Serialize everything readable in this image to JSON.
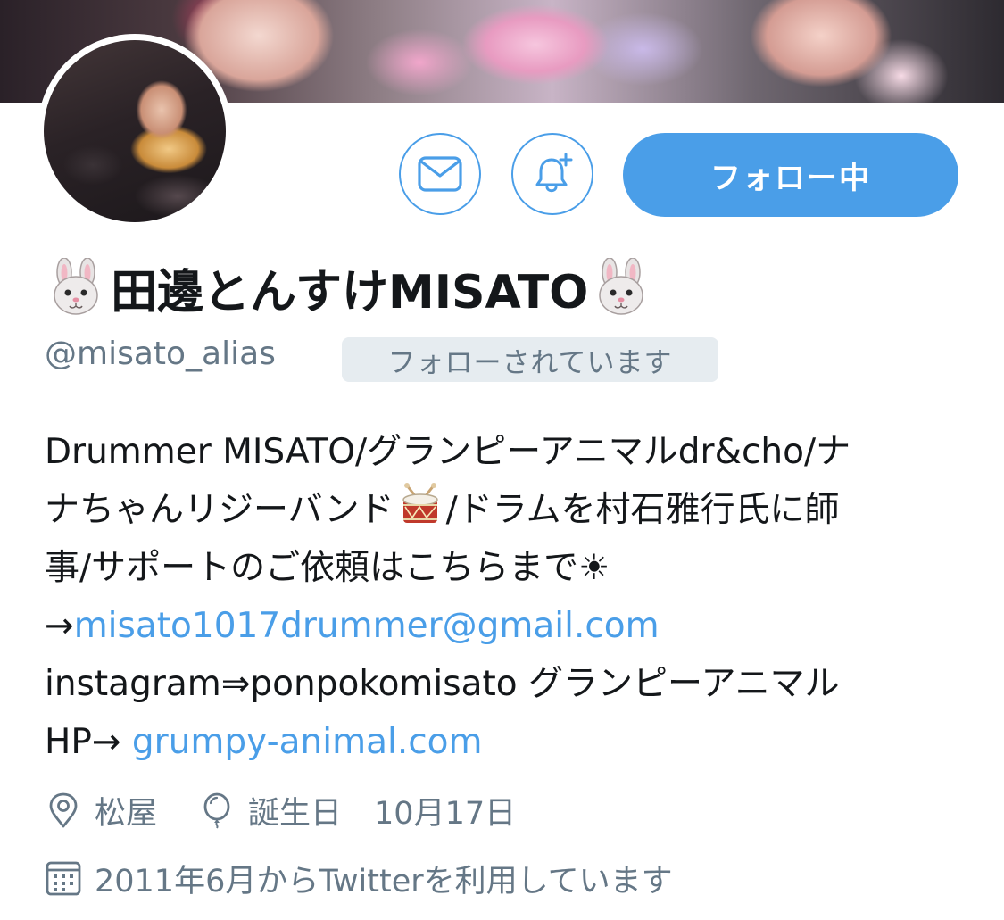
{
  "profile": {
    "display_name": "田邊とんすけMISATO",
    "handle": "@misato_alias",
    "follows_you": "フォローされています",
    "follow_button": "フォロー中"
  },
  "bio": {
    "l1": "Drummer MISATO/グランピーアニマルdr&cho/ナ",
    "l2a": "ナちゃんリジーバンド",
    "l2b": "/ドラムを村石雅行氏に師",
    "l3": "事/サポートのご依頼はこちらまで☀",
    "l4_arrow": "→",
    "email": "misato1017drummer@gmail.com",
    "l5": "instagram⇒ponpokomisato グランピーアニマル",
    "l6_prefix": "HP→ ",
    "website": "grumpy-animal.com"
  },
  "meta": {
    "location": "松屋",
    "birthday_label": "誕生日",
    "birthday": "10月17日",
    "joined": "2011年6月からTwitterを利用しています"
  },
  "icons": {
    "name_prefix": "rabbit-face-icon",
    "name_suffix": "rabbit-face-icon",
    "bio_emoji": "drum-icon",
    "message": "envelope-icon",
    "notify": "bell-plus-icon",
    "location": "location-pin-icon",
    "birthday": "balloon-icon",
    "joined": "calendar-icon"
  },
  "colors": {
    "accent": "#4a9ee8",
    "secondary_text": "#657786",
    "badge_bg": "#e6ecf0"
  }
}
